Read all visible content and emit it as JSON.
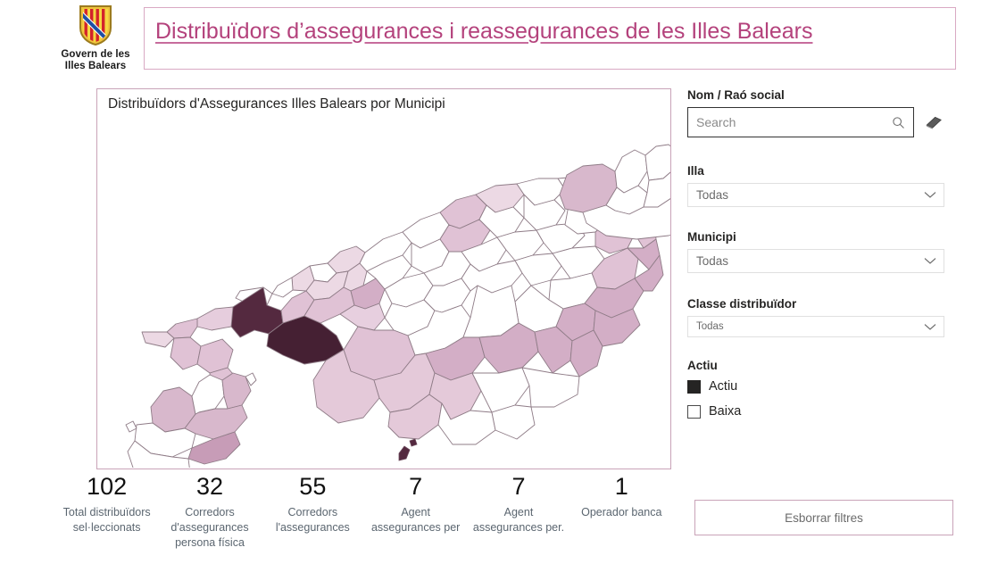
{
  "header": {
    "crest_caption_line1": "Govern de les",
    "crest_caption_line2": "Illes Balears",
    "title": "Distribuïdors d’assegurances i reassegurances de les Illes Balears",
    "crest_icon": "balearic-coat-of-arms"
  },
  "map_panel": {
    "title": "Distribuïdors d'Assegurances Illes Balears por Municipi",
    "legend_colors": [
      "#ffffff",
      "#ecd9e4",
      "#e0c2d5",
      "#d3aec6",
      "#b98bab",
      "#54293f",
      "#452033"
    ]
  },
  "kpis": [
    {
      "value": "102",
      "label_line1": "Total distribuïdors",
      "label_line2": "sel·leccionats",
      "label_line3": ""
    },
    {
      "value": "32",
      "label_line1": "Corredors",
      "label_line2": "d'assegurances",
      "label_line3": "persona física"
    },
    {
      "value": "55",
      "label_line1": "Corredors",
      "label_line2": "l'assegurances",
      "label_line3": ""
    },
    {
      "value": "7",
      "label_line1": "Agent",
      "label_line2": "assegurances per",
      "label_line3": ""
    },
    {
      "value": "7",
      "label_line1": "Agent",
      "label_line2": "assegurances per.",
      "label_line3": ""
    },
    {
      "value": "1",
      "label_line1": "Operador banca",
      "label_line2": "",
      "label_line3": ""
    }
  ],
  "sidebar": {
    "search": {
      "label": "Nom / Raó social",
      "placeholder": "Search",
      "value": "",
      "search_icon": "magnifier-icon",
      "eraser_icon": "eraser-icon"
    },
    "illa": {
      "label": "Illa",
      "value": "Todas",
      "chevron_icon": "chevron-down-icon"
    },
    "municipi": {
      "label": "Municipi",
      "value": "Todas",
      "chevron_icon": "chevron-down-icon"
    },
    "classe": {
      "label": "Classe distribuïdor",
      "value": "Todas",
      "chevron_icon": "chevron-down-icon"
    },
    "actiu": {
      "label": "Actiu",
      "options": [
        {
          "label": "Actiu",
          "checked": true
        },
        {
          "label": "Baixa",
          "checked": false
        }
      ]
    },
    "clear_button": "Esborrar filtres"
  },
  "colors": {
    "brand_pink": "#b4427c",
    "panel_border": "#c9a3b8",
    "map_dark": "#54293f",
    "map_mid": "#d3aec6",
    "map_light": "#ecd9e4"
  }
}
